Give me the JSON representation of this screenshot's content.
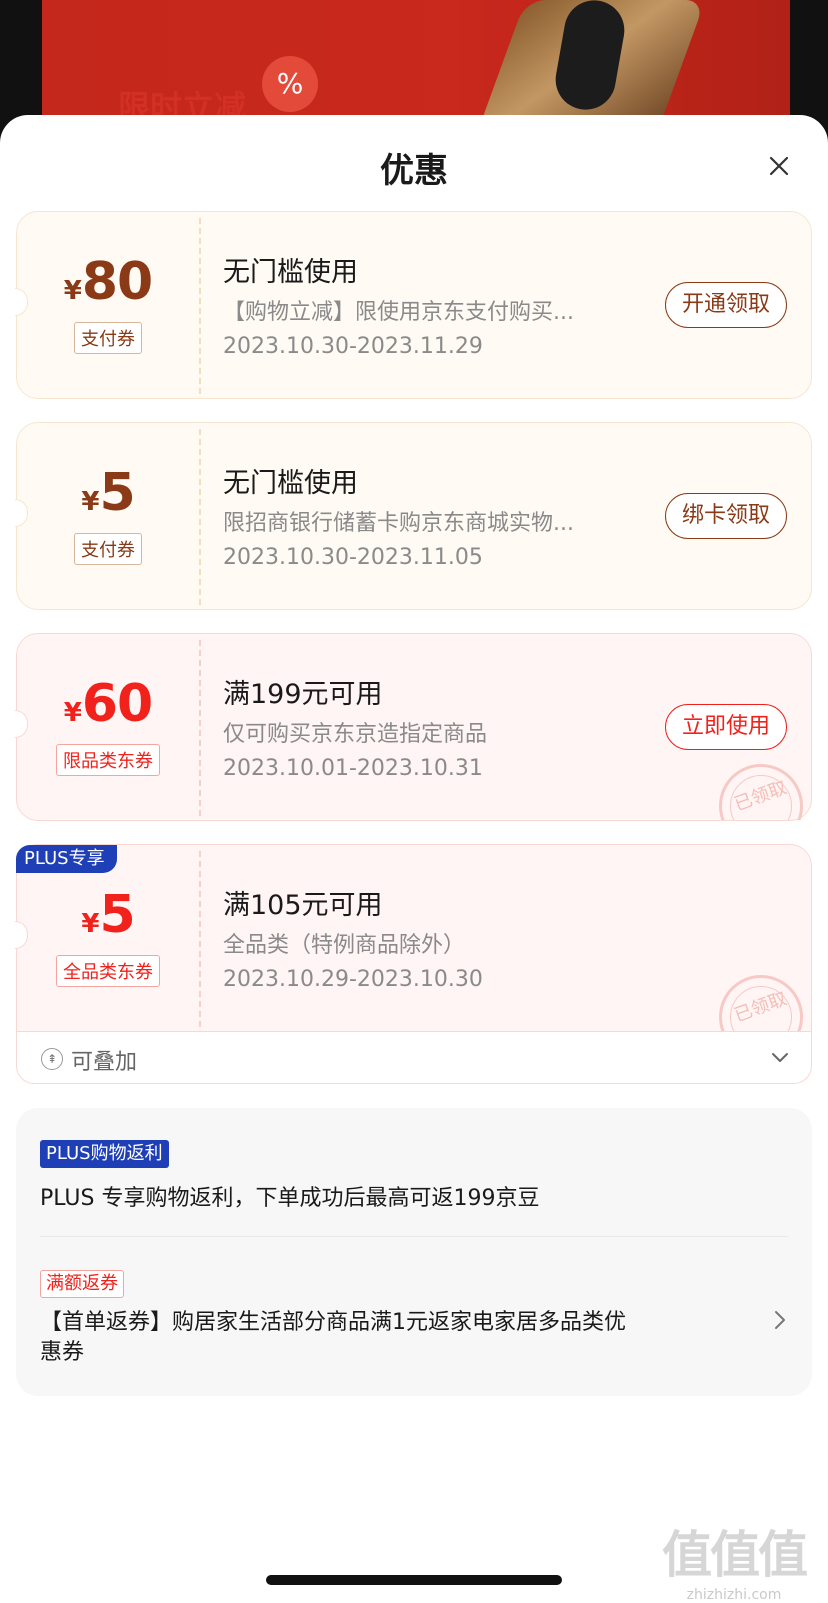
{
  "background": {
    "promo_text": "限时立减",
    "promo_badge": "%"
  },
  "sheet": {
    "title": "优惠",
    "close_icon": "close-icon"
  },
  "coupons": [
    {
      "symbol": "¥",
      "amount": "80",
      "type": "支付券",
      "title": "无门槛使用",
      "desc": "【购物立减】限使用京东支付购买...",
      "date": "2023.10.30-2023.11.29",
      "button": "开通领取"
    },
    {
      "symbol": "¥",
      "amount": "5",
      "type": "支付券",
      "title": "无门槛使用",
      "desc": "限招商银行储蓄卡购京东商城实物...",
      "date": "2023.10.30-2023.11.05",
      "button": "绑卡领取"
    },
    {
      "symbol": "¥",
      "amount": "60",
      "type": "限品类东券",
      "title": "满199元可用",
      "desc": "仅可购买京东京造指定商品",
      "date": "2023.10.01-2023.10.31",
      "button": "立即使用",
      "stamp": "已领取"
    },
    {
      "badge": "PLUS专享",
      "symbol": "¥",
      "amount": "5",
      "type": "全品类东券",
      "title": "满105元可用",
      "desc": "全品类（特例商品除外）",
      "date": "2023.10.29-2023.10.30",
      "stamp": "已领取"
    }
  ],
  "stack": {
    "label": "可叠加",
    "icon": "stack-icon",
    "chevron": "chevron-down-icon"
  },
  "benefits": {
    "plus": {
      "tag": "PLUS购物返利",
      "text": "PLUS 专享购物返利，下单成功后最高可返199京豆"
    },
    "coupon_return": {
      "tag": "满额返券",
      "text": "【首单返券】购居家生活部分商品满1元返家电家居多品类优惠券"
    }
  },
  "watermark": {
    "logo": "值值值",
    "url": "zhizhizhi.com"
  },
  "colors": {
    "pay_accent": "#8a3a16",
    "dong_accent": "#f1221c",
    "plus_blue": "#1f3fb6"
  }
}
